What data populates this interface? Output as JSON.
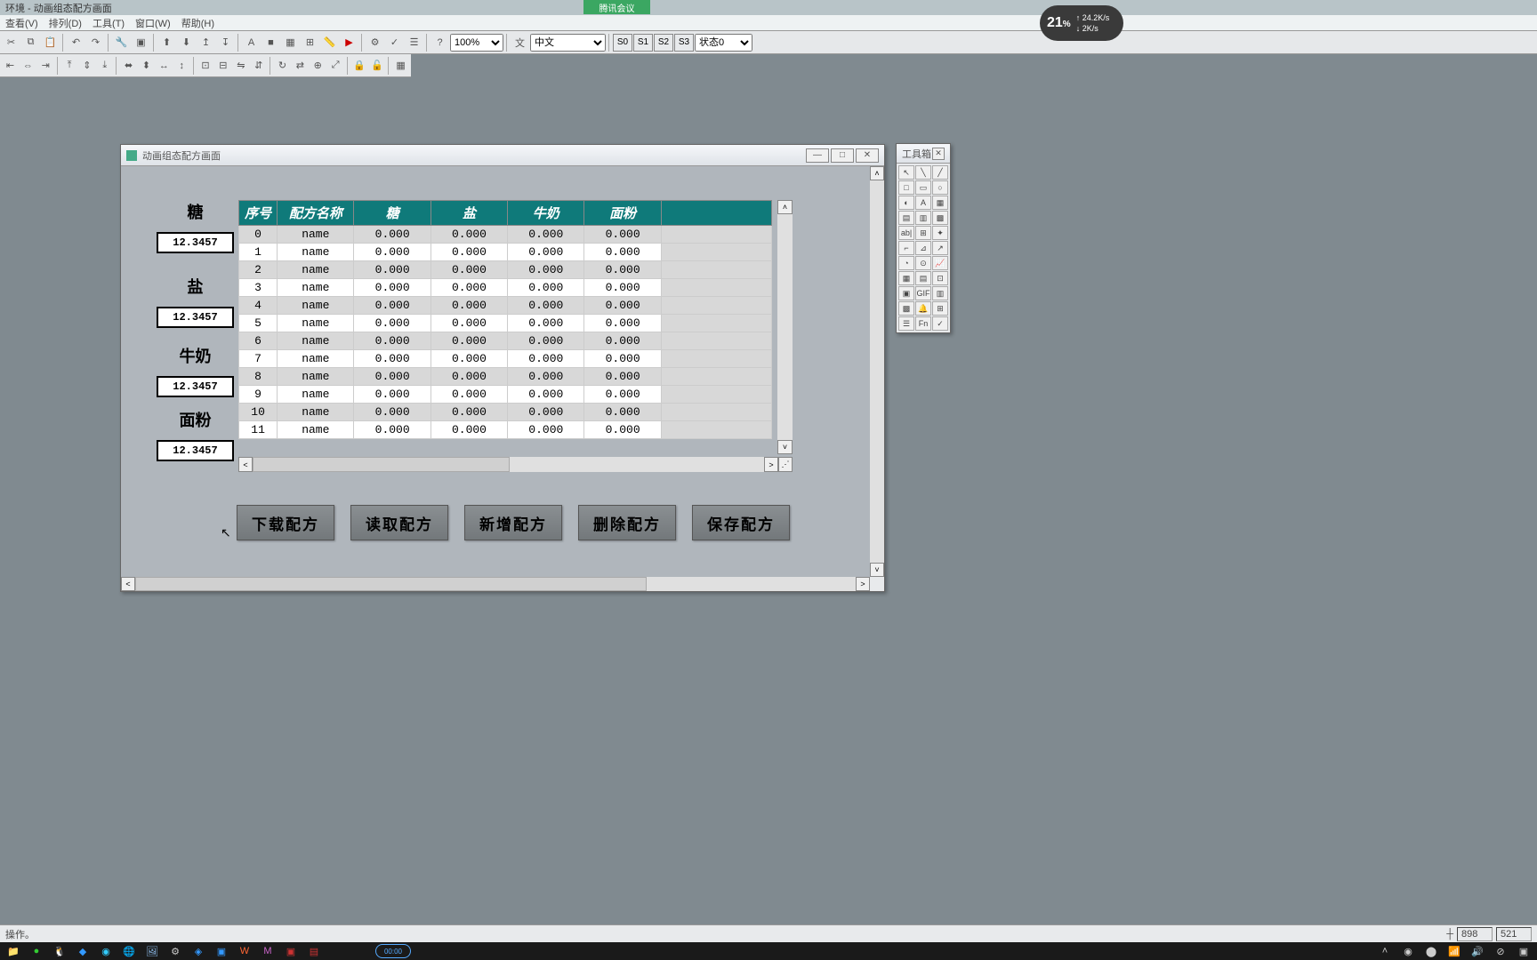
{
  "top": {
    "title": "环境 - 动画组态配方画面",
    "tencent": "腾讯会议",
    "perf_pct": "21",
    "perf_unit": "%",
    "net_up": "↑ 24.2K/s",
    "net_down": "↓ 2K/s"
  },
  "menu": {
    "items": [
      "查看(V)",
      "排列(D)",
      "工具(T)",
      "窗口(W)",
      "帮助(H)"
    ]
  },
  "toolbar": {
    "zoom": "100%",
    "lang": "中文",
    "s0": "S0",
    "s1": "S1",
    "s2": "S2",
    "s3": "S3",
    "state": "状态0"
  },
  "toolbox": {
    "title": "工具箱"
  },
  "design": {
    "title": "动画组态配方画面",
    "params": [
      {
        "label": "糖",
        "value": "12.3457"
      },
      {
        "label": "盐",
        "value": "12.3457"
      },
      {
        "label": "牛奶",
        "value": "12.3457"
      },
      {
        "label": "面粉",
        "value": "12.3457"
      }
    ],
    "grid": {
      "headers": [
        "序号",
        "配方名称",
        "糖",
        "盐",
        "牛奶",
        "面粉"
      ],
      "rows": [
        {
          "idx": "0",
          "name": "name",
          "v1": "0.000",
          "v2": "0.000",
          "v3": "0.000",
          "v4": "0.000"
        },
        {
          "idx": "1",
          "name": "name",
          "v1": "0.000",
          "v2": "0.000",
          "v3": "0.000",
          "v4": "0.000"
        },
        {
          "idx": "2",
          "name": "name",
          "v1": "0.000",
          "v2": "0.000",
          "v3": "0.000",
          "v4": "0.000"
        },
        {
          "idx": "3",
          "name": "name",
          "v1": "0.000",
          "v2": "0.000",
          "v3": "0.000",
          "v4": "0.000"
        },
        {
          "idx": "4",
          "name": "name",
          "v1": "0.000",
          "v2": "0.000",
          "v3": "0.000",
          "v4": "0.000"
        },
        {
          "idx": "5",
          "name": "name",
          "v1": "0.000",
          "v2": "0.000",
          "v3": "0.000",
          "v4": "0.000"
        },
        {
          "idx": "6",
          "name": "name",
          "v1": "0.000",
          "v2": "0.000",
          "v3": "0.000",
          "v4": "0.000"
        },
        {
          "idx": "7",
          "name": "name",
          "v1": "0.000",
          "v2": "0.000",
          "v3": "0.000",
          "v4": "0.000"
        },
        {
          "idx": "8",
          "name": "name",
          "v1": "0.000",
          "v2": "0.000",
          "v3": "0.000",
          "v4": "0.000"
        },
        {
          "idx": "9",
          "name": "name",
          "v1": "0.000",
          "v2": "0.000",
          "v3": "0.000",
          "v4": "0.000"
        },
        {
          "idx": "10",
          "name": "name",
          "v1": "0.000",
          "v2": "0.000",
          "v3": "0.000",
          "v4": "0.000"
        },
        {
          "idx": "11",
          "name": "name",
          "v1": "0.000",
          "v2": "0.000",
          "v3": "0.000",
          "v4": "0.000"
        }
      ]
    },
    "buttons": [
      "下载配方",
      "读取配方",
      "新增配方",
      "删除配方",
      "保存配方"
    ]
  },
  "status": {
    "text": "操作。",
    "x": "898",
    "y": "521"
  }
}
